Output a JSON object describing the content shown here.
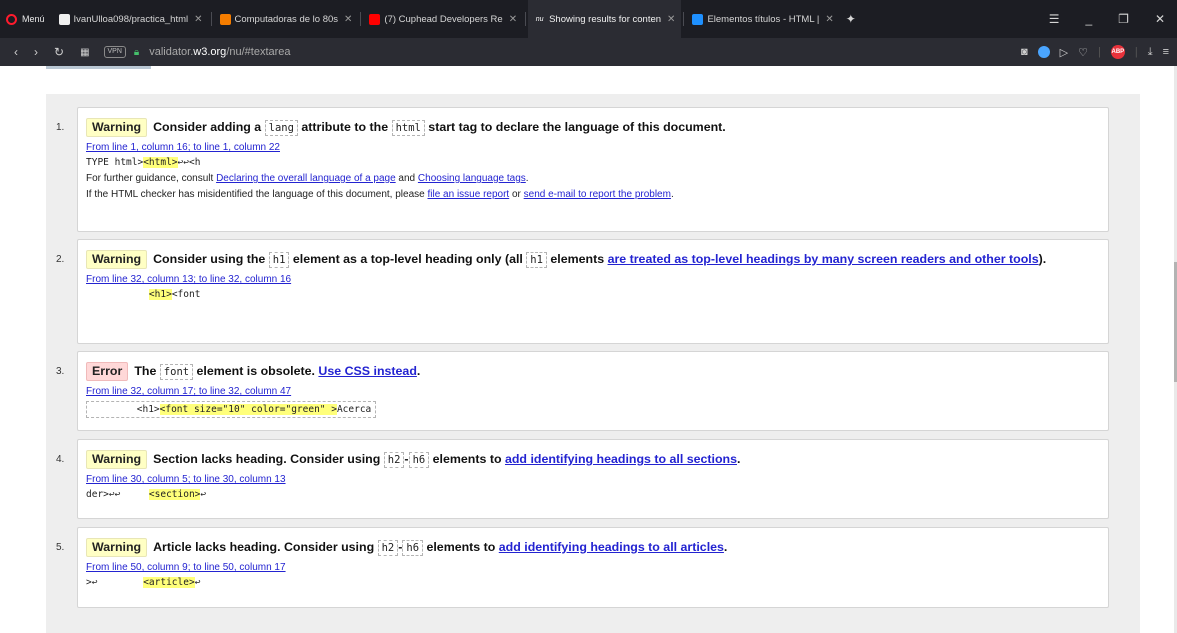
{
  "browser": {
    "menu_label": "Menú",
    "tabs": [
      {
        "title": "IvanUlloa098/practica_html",
        "favicon": "github-icon",
        "color": "#f0f0f0"
      },
      {
        "title": "Computadoras de lo 80s",
        "favicon": "blogger-icon",
        "color": "#f57d00"
      },
      {
        "title": "(7) Cuphead Developers Re",
        "favicon": "youtube-icon",
        "color": "#ff0000"
      },
      {
        "title": "Showing results for conten",
        "favicon": "nu-icon",
        "color": "#6e8fb5",
        "active": true,
        "fav_text": "nu"
      },
      {
        "title": "Elementos títulos - HTML |",
        "favicon": "mdn-icon",
        "color": "#1e90ff"
      }
    ],
    "vpn_label": "VPN",
    "url_prefix": "validator.",
    "url_domain": "w3.org",
    "url_path": "/nu/#textarea",
    "adblock_label": "ABP"
  },
  "messages": [
    {
      "num": "1.",
      "type": "Warning",
      "parts": [
        {
          "t": "Consider adding a "
        },
        {
          "c": "lang"
        },
        {
          "t": " attribute to the "
        },
        {
          "c": "html"
        },
        {
          "t": " start tag to declare the language of this document."
        }
      ],
      "location": "From line 1, column 16; to line 1, column 22",
      "extract": [
        {
          "t": "TYPE html>"
        },
        {
          "h": "<html>"
        },
        {
          "t": "↩"
        },
        {
          "t": "↩<h"
        }
      ],
      "guidance": [
        [
          {
            "t": "For further guidance, consult "
          },
          {
            "l": "Declaring the overall language of a page"
          },
          {
            "t": " and "
          },
          {
            "l": "Choosing language tags"
          },
          {
            "t": "."
          }
        ],
        [
          {
            "t": "If the HTML checker has misidentified the language of this document, please "
          },
          {
            "l": "file an issue report"
          },
          {
            "t": " or "
          },
          {
            "l": "send e-mail to report the problem"
          },
          {
            "t": "."
          }
        ]
      ]
    },
    {
      "num": "2.",
      "type": "Warning",
      "parts": [
        {
          "t": "Consider using the "
        },
        {
          "c": "h1"
        },
        {
          "t": " element as a top-level heading only (all "
        },
        {
          "c": "h1"
        },
        {
          "t": " elements "
        },
        {
          "l": "are treated as top-level headings by many screen readers and other tools"
        },
        {
          "t": ")."
        }
      ],
      "location": "From line 32, column 13; to line 32, column 16",
      "extract": [
        {
          "t": "           "
        },
        {
          "h": "<h1>"
        },
        {
          "t": "<font"
        }
      ]
    },
    {
      "num": "3.",
      "type": "Error",
      "parts": [
        {
          "t": "The "
        },
        {
          "c": "font"
        },
        {
          "t": " element is obsolete. "
        },
        {
          "l": "Use CSS instead"
        },
        {
          "t": "."
        }
      ],
      "location": "From line 32, column 17; to line 32, column 47",
      "boxed": true,
      "extract": [
        {
          "t": "        <h1>"
        },
        {
          "h": "<font size=\"10\" color=\"green\" >"
        },
        {
          "t": "Acerca"
        }
      ]
    },
    {
      "num": "4.",
      "type": "Warning",
      "parts": [
        {
          "t": "Section lacks heading. Consider using "
        },
        {
          "c": "h2"
        },
        {
          "t": "-"
        },
        {
          "c": "h6"
        },
        {
          "t": " elements to "
        },
        {
          "l": "add identifying headings to all sections"
        },
        {
          "t": "."
        }
      ],
      "location": "From line 30, column 5; to line 30, column 13",
      "extract": [
        {
          "t": "der>↩↩     "
        },
        {
          "h": "<section>"
        },
        {
          "t": "↩"
        }
      ]
    },
    {
      "num": "5.",
      "type": "Warning",
      "parts": [
        {
          "t": "Article lacks heading. Consider using "
        },
        {
          "c": "h2"
        },
        {
          "t": "-"
        },
        {
          "c": "h6"
        },
        {
          "t": " elements to "
        },
        {
          "l": "add identifying headings to all articles"
        },
        {
          "t": "."
        }
      ],
      "location": "From line 50, column 9; to line 50, column 17",
      "extract": [
        {
          "t": ">↩        "
        },
        {
          "h": "<article>"
        },
        {
          "t": "↩"
        }
      ]
    }
  ]
}
